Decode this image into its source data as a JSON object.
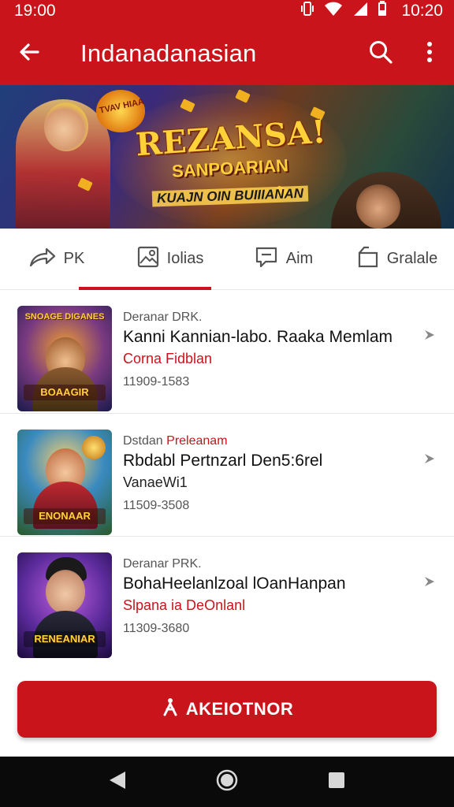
{
  "status_bar": {
    "left_time": "19:00",
    "right_time": "10:20",
    "icons": [
      "vibrate-icon",
      "wifi-icon",
      "signal-icon",
      "battery-icon"
    ]
  },
  "app_bar": {
    "title": "Indanadanasian",
    "icons": [
      "back-arrow-icon",
      "search-icon",
      "more-vert-icon"
    ]
  },
  "banner": {
    "badge_text": "TVAV HIAA",
    "headline": "REZANSA!",
    "subheadline": "SANPOARIAN",
    "tagline": "KUAJN OIN BUIIIANAN"
  },
  "tabs": [
    {
      "label": "PK",
      "icon": "share-arrow-icon",
      "active": false
    },
    {
      "label": "Iolias",
      "icon": "gallery-icon",
      "active": true
    },
    {
      "label": "Aim",
      "icon": "chat-icon",
      "active": false
    },
    {
      "label": "Gralale",
      "icon": "open-box-icon",
      "active": false
    }
  ],
  "list": [
    {
      "kicker": "Deranar DRK.",
      "kicker_highlight": "",
      "name": "Kanni Kannian-labo. Raaka Memlam",
      "sub": "Corna Fidblan",
      "sub_red": true,
      "meta": "11909-1583",
      "thumb_caption": "BOAAGIR",
      "thumb_badge": "SNOAGE DIGANES"
    },
    {
      "kicker": "Dstdan",
      "kicker_highlight": "Preleanam",
      "name": "Rbdabl Pertnzarl Den5:6rel",
      "sub": "VanaeWi1",
      "sub_red": false,
      "meta": "11509-3508",
      "thumb_caption": "ENONAAR",
      "thumb_badge": ""
    },
    {
      "kicker": "Deranar PRK.",
      "kicker_highlight": "",
      "name": "BohaHeelanlzoal lOanHanpan",
      "sub": "Slpana ia DeOnlanl",
      "sub_red": true,
      "meta": "11309-3680",
      "thumb_caption": "RENEANIAR",
      "thumb_badge": ""
    }
  ],
  "cta": {
    "label": "AKEIOTNOR",
    "icon": "person-walk-icon"
  },
  "nav_bar": {
    "icons": [
      "nav-back-icon",
      "nav-home-icon",
      "nav-recents-icon"
    ]
  },
  "colors": {
    "primary": "#c8141a",
    "text": "#111111",
    "muted": "#555555",
    "divider": "#e6e6e6",
    "nav": "#0a0a0a"
  }
}
